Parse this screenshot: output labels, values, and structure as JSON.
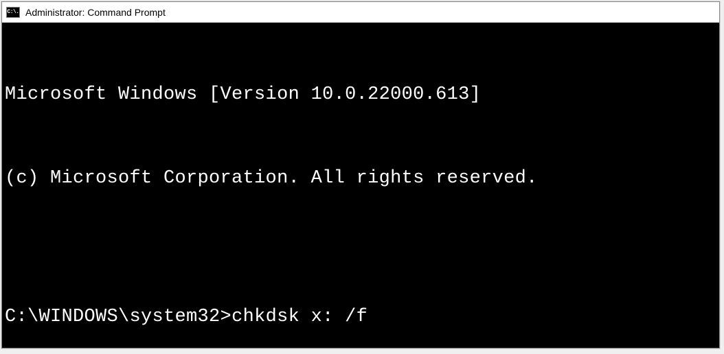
{
  "titlebar": {
    "icon_text": "C:\\.",
    "title": "Administrator: Command Prompt"
  },
  "terminal": {
    "line1": "Microsoft Windows [Version 10.0.22000.613]",
    "line2": "(c) Microsoft Corporation. All rights reserved.",
    "blank": "",
    "prompt": "C:\\WINDOWS\\system32>",
    "command": "chkdsk x: /f"
  }
}
